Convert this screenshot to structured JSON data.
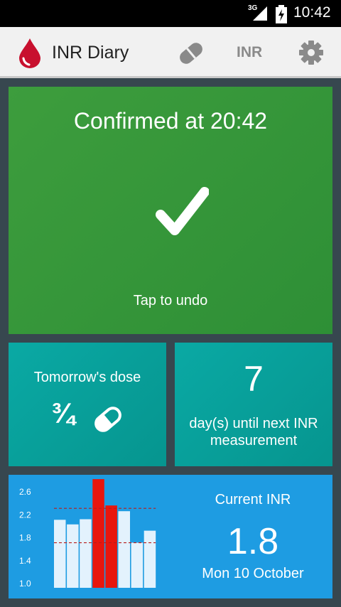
{
  "status_bar": {
    "network": "3G",
    "time": "10:42",
    "icons": [
      "signal-icon",
      "battery-icon"
    ]
  },
  "app_bar": {
    "title": "INR Diary",
    "inr_action": "INR",
    "icons": {
      "logo": "blood-drop-icon",
      "medication": "pill-icon",
      "settings": "gear-icon"
    },
    "logo_color": "#c8102e"
  },
  "confirmation": {
    "title": "Confirmed at 20:42",
    "icon": "checkmark-icon",
    "action": "Tap to undo",
    "color": "#3d9d3d"
  },
  "dose": {
    "label": "Tomorrow's dose",
    "amount": "¾",
    "icon": "pill-icon",
    "color": "#0aa9a4"
  },
  "next_measurement": {
    "days": "7",
    "label": "day(s) until next INR measurement"
  },
  "current_inr": {
    "label": "Current INR",
    "value": "1.8",
    "date": "Mon 10 October",
    "color": "#1e9ce2"
  },
  "chart_data": {
    "type": "bar",
    "ytick_labels": [
      "2.6",
      "2.2",
      "1.8",
      "1.4",
      "1.0"
    ],
    "yticks": [
      2.6,
      2.2,
      1.8,
      1.4,
      1.0
    ],
    "ylim": [
      1.0,
      2.6
    ],
    "target_range": [
      1.7,
      2.3
    ],
    "values": [
      2.1,
      2.02,
      2.11,
      2.81,
      2.35,
      2.25,
      1.7,
      1.91
    ],
    "in_range_color": "#e3f2fd",
    "out_of_range_color": "#e8160e",
    "grid": false
  }
}
